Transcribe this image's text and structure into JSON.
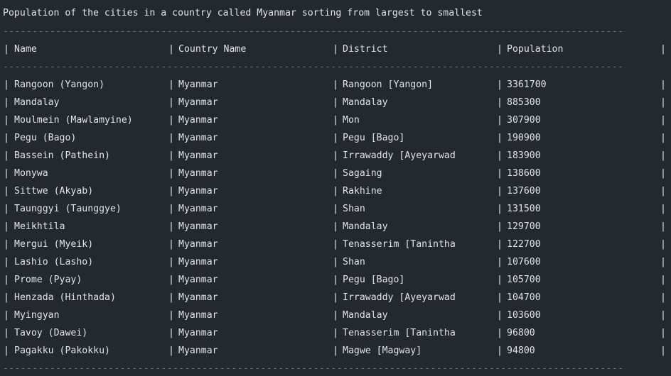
{
  "title": "Population of the cities in a country called Myanmar sorting from largest to smallest",
  "separator": "------------------------------------------------------------------------------------------------------------------------------------------------------------------------",
  "pipe": "|",
  "columns": [
    "Name",
    "Country Name",
    "District",
    "Population"
  ],
  "rows": [
    [
      "Rangoon (Yangon)",
      "Myanmar",
      "Rangoon [Yangon]",
      "3361700"
    ],
    [
      "Mandalay",
      "Myanmar",
      "Mandalay",
      "885300"
    ],
    [
      "Moulmein (Mawlamyine)",
      "Myanmar",
      "Mon",
      "307900"
    ],
    [
      "Pegu (Bago)",
      "Myanmar",
      "Pegu [Bago]",
      "190900"
    ],
    [
      "Bassein (Pathein)",
      "Myanmar",
      "Irrawaddy [Ayeyarwad",
      "183900"
    ],
    [
      "Monywa",
      "Myanmar",
      "Sagaing",
      "138600"
    ],
    [
      "Sittwe (Akyab)",
      "Myanmar",
      "Rakhine",
      "137600"
    ],
    [
      "Taunggyi (Taunggye)",
      "Myanmar",
      "Shan",
      "131500"
    ],
    [
      "Meikhtila",
      "Myanmar",
      "Mandalay",
      "129700"
    ],
    [
      "Mergui (Myeik)",
      "Myanmar",
      "Tenasserim [Tanintha",
      "122700"
    ],
    [
      "Lashio (Lasho)",
      "Myanmar",
      "Shan",
      "107600"
    ],
    [
      "Prome (Pyay)",
      "Myanmar",
      "Pegu [Bago]",
      "105700"
    ],
    [
      "Henzada (Hinthada)",
      "Myanmar",
      "Irrawaddy [Ayeyarwad",
      "104700"
    ],
    [
      "Myingyan",
      "Myanmar",
      "Mandalay",
      "103600"
    ],
    [
      "Tavoy (Dawei)",
      "Myanmar",
      "Tenasserim [Tanintha",
      "96800"
    ],
    [
      "Pagakku (Pakokku)",
      "Myanmar",
      "Magwe [Magway]",
      "94800"
    ]
  ]
}
